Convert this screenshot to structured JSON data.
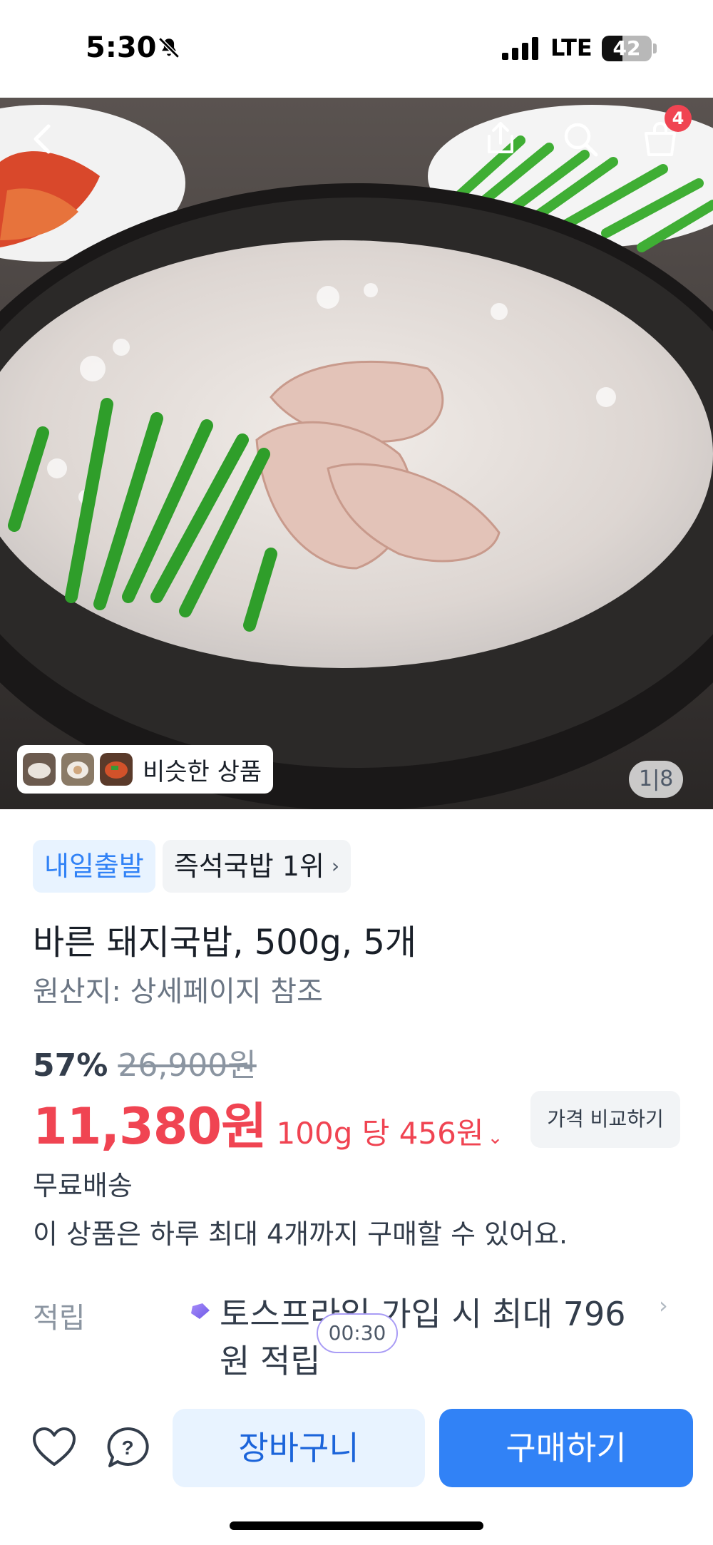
{
  "status_bar": {
    "time": "5:30",
    "network": "LTE",
    "battery": "42",
    "battery_level": 0.42,
    "icons": [
      "bell-slash-icon",
      "signal-icon",
      "battery-icon"
    ]
  },
  "header": {
    "icons": [
      "back-icon",
      "share-icon",
      "search-icon",
      "cart-icon"
    ],
    "cart_badge": "4"
  },
  "gallery": {
    "similar_label": "비슷한 상품",
    "page_current": "1",
    "page_total": "8"
  },
  "badges": {
    "delivery": "내일출발",
    "ranking": "즉석국밥 1위"
  },
  "product": {
    "title": "바른 돼지국밥, 500g, 5개",
    "origin": "원산지: 상세페이지 참조"
  },
  "pricing": {
    "discount": "57%",
    "original_price": "26,900원",
    "price": "11,380원",
    "unit_price": "100g 당 456원",
    "compare_label": "가격 비교하기"
  },
  "shipping": {
    "text": "무료배송",
    "limit_text": "이 상품은 하루 최대 4개까지 구매할 수 있어요."
  },
  "points": {
    "label": "적립",
    "text": "토스프라임 가입 시 최대 796원 적립",
    "timer": "00:30"
  },
  "actions": {
    "cart_label": "장바구니",
    "buy_label": "구매하기",
    "icons": [
      "heart-icon",
      "question-icon"
    ]
  },
  "colors": {
    "accent_blue": "#3182f6",
    "price_red": "#f04452",
    "badge_blue_bg": "#e8f3ff"
  }
}
